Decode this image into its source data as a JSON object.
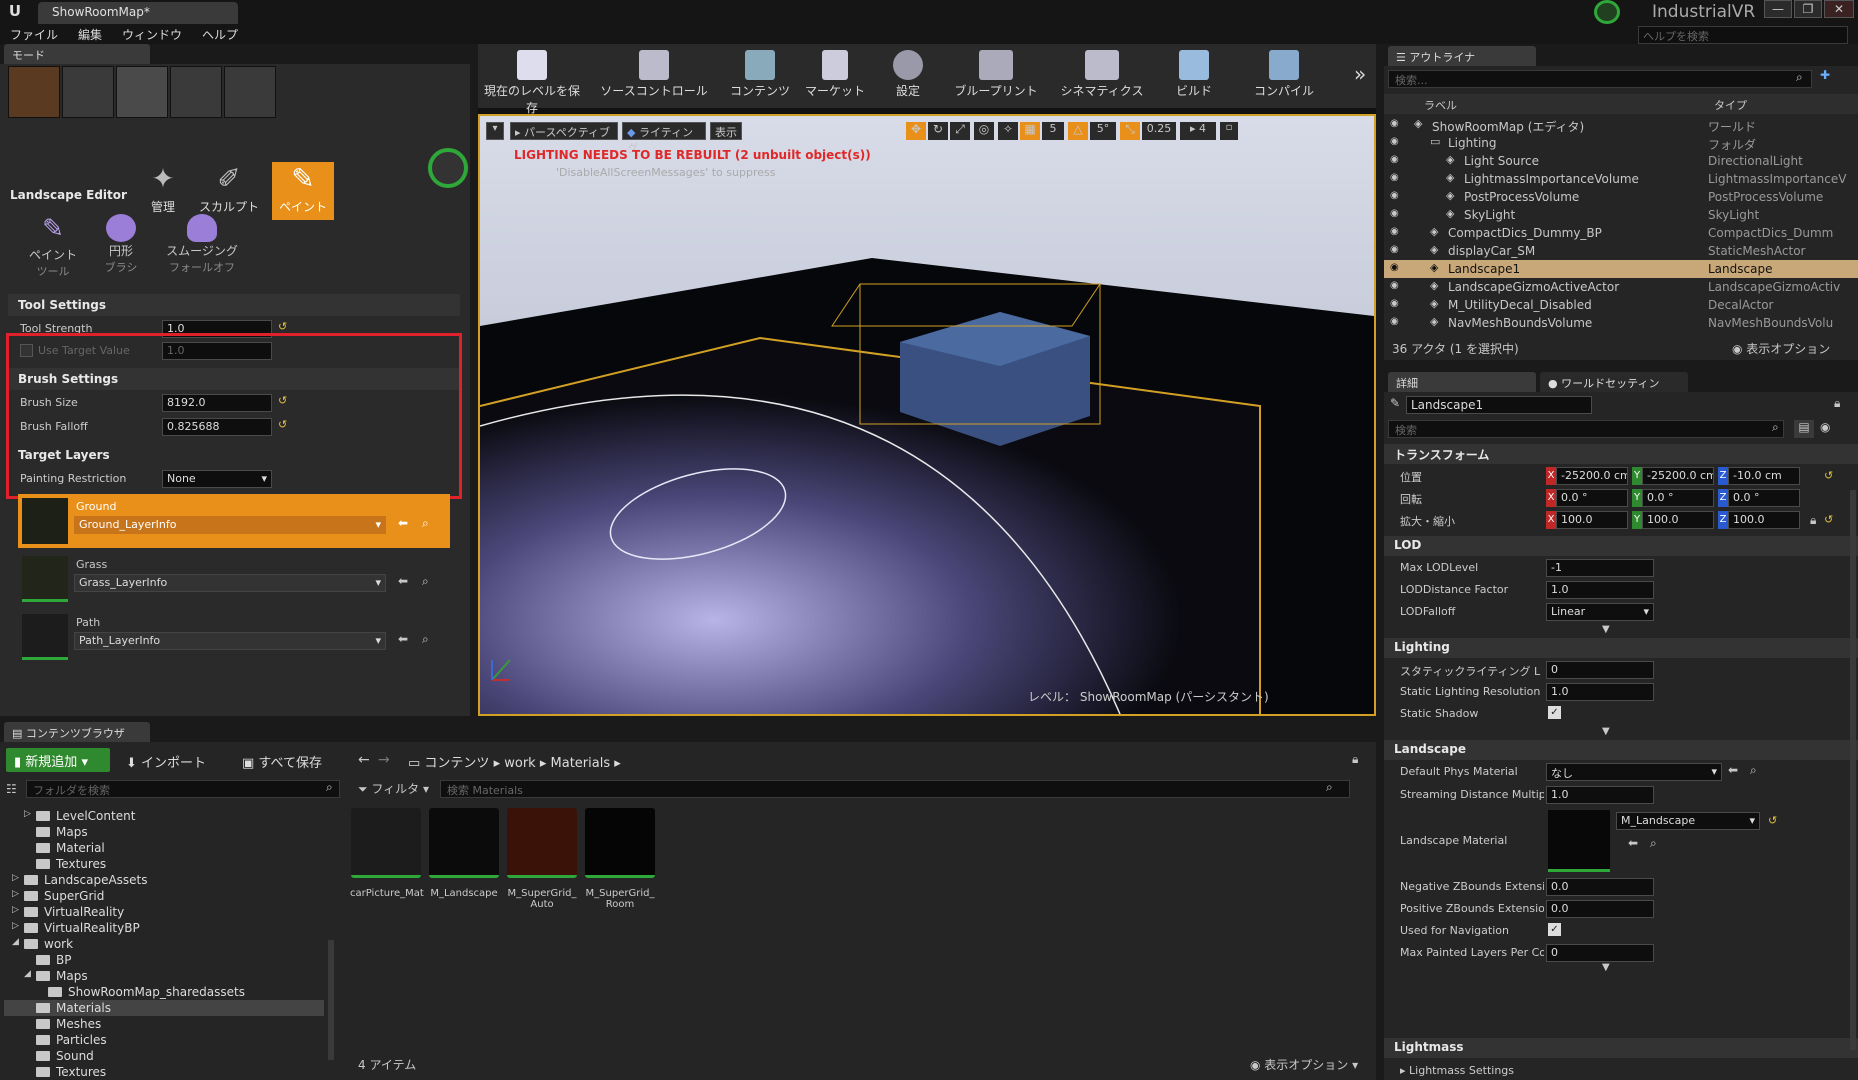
{
  "window": {
    "app_icon": "unreal-logo",
    "tab_title": "ShowRoomMap*",
    "app_name": "IndustrialVR",
    "help_search_placeholder": "ヘルプを検索",
    "controls": [
      "—",
      "❐",
      "✕"
    ]
  },
  "menu": [
    "ファイル",
    "編集",
    "ウィンドウ",
    "ヘルプ"
  ],
  "modes": {
    "tab_label": "モード",
    "sub_modes": [
      {
        "label": "管理",
        "icon": "manage-icon"
      },
      {
        "label": "スカルプト",
        "icon": "sculpt-icon"
      },
      {
        "label": "ペイント",
        "icon": "paint-icon",
        "active": true
      }
    ],
    "landscape_editor_title": "Landscape Editor",
    "tools": [
      {
        "label": "ペイント",
        "sub": "ツール"
      },
      {
        "label": "円形",
        "sub": "ブラシ"
      },
      {
        "label": "スムージング",
        "sub": "フォールオフ"
      }
    ],
    "tool_settings": {
      "title": "Tool Settings",
      "tool_strength_label": "Tool Strength",
      "tool_strength": "1.0",
      "use_target_label": "Use Target Value",
      "use_target_value": "1.0"
    },
    "brush_settings": {
      "title": "Brush Settings",
      "size_label": "Brush Size",
      "size": "8192.0",
      "falloff_label": "Brush Falloff",
      "falloff": "0.825688"
    },
    "target_layers_title": "Target Layers",
    "painting_restriction_label": "Painting Restriction",
    "painting_restriction": "None",
    "layers": [
      {
        "name": "Ground",
        "info": "Ground_LayerInfo",
        "selected": true
      },
      {
        "name": "Grass",
        "info": "Grass_LayerInfo",
        "selected": false
      },
      {
        "name": "Path",
        "info": "Path_LayerInfo",
        "selected": false
      }
    ]
  },
  "toolbar": [
    {
      "label": "現在のレベルを保存",
      "icon": "save-icon"
    },
    {
      "label": "ソースコントロール",
      "icon": "source-control-icon"
    },
    {
      "label": "コンテンツ",
      "icon": "content-icon"
    },
    {
      "label": "マーケット",
      "icon": "market-icon"
    },
    {
      "label": "設定",
      "icon": "settings-icon"
    },
    {
      "label": "ブループリント",
      "icon": "blueprint-icon"
    },
    {
      "label": "シネマティクス",
      "icon": "cinematics-icon"
    },
    {
      "label": "ビルド",
      "icon": "build-icon"
    },
    {
      "label": "コンパイル",
      "icon": "compile-icon"
    }
  ],
  "viewport": {
    "perspective": "パースペクティブ",
    "lighting": "ライティング",
    "show": "表示",
    "grid_snap": "5",
    "rot_snap": "5°",
    "scale_snap": "0.25",
    "cam_speed": "4",
    "warning": "LIGHTING NEEDS TO BE REBUILT (2 unbuilt object(s))",
    "warning_sub": "'DisableAllScreenMessages' to suppress",
    "level_label": "レベル：",
    "level_name": "ShowRoomMap (パーシスタント)",
    "colors": {
      "warning": "#e02828",
      "selection": "#d2a024"
    }
  },
  "outliner": {
    "tab": "アウトライナ",
    "search_placeholder": "検索...",
    "col_label": "ラベル",
    "col_type": "タイプ",
    "rows": [
      {
        "label": "ShowRoomMap (エディタ)",
        "type": "ワールド",
        "indent": 0,
        "icon": "world-icon"
      },
      {
        "label": "Lighting",
        "type": "フォルダ",
        "indent": 1,
        "icon": "folder-icon"
      },
      {
        "label": "Light Source",
        "type": "DirectionalLight",
        "indent": 2,
        "icon": "light-icon"
      },
      {
        "label": "LightmassImportanceVolume",
        "type": "LightmassImportanceV",
        "indent": 2,
        "icon": "volume-icon"
      },
      {
        "label": "PostProcessVolume",
        "type": "PostProcessVolume",
        "indent": 2,
        "icon": "volume-icon"
      },
      {
        "label": "SkyLight",
        "type": "SkyLight",
        "indent": 2,
        "icon": "skylight-icon"
      },
      {
        "label": "CompactDics_Dummy_BP",
        "type": "CompactDics_Dumm",
        "indent": 1,
        "icon": "actor-icon"
      },
      {
        "label": "displayCar_SM",
        "type": "StaticMeshActor",
        "indent": 1,
        "icon": "mesh-icon"
      },
      {
        "label": "Landscape1",
        "type": "Landscape",
        "indent": 1,
        "icon": "landscape-icon",
        "selected": true
      },
      {
        "label": "LandscapeGizmoActiveActor",
        "type": "LandscapeGizmoActiv",
        "indent": 1,
        "icon": "gizmo-icon"
      },
      {
        "label": "M_UtilityDecal_Disabled",
        "type": "DecalActor",
        "indent": 1,
        "icon": "decal-icon"
      },
      {
        "label": "NavMeshBoundsVolume",
        "type": "NavMeshBoundsVolu",
        "indent": 1,
        "icon": "volume-icon"
      }
    ],
    "footer_count": "36 アクタ (1 を選択中)",
    "footer_options": "表示オプション"
  },
  "details": {
    "tab": "詳細",
    "tab2": "ワールドセッティン",
    "object_name": "Landscape1",
    "search_placeholder": "検索",
    "transform_title": "トランスフォーム",
    "location_label": "位置",
    "location": [
      "-25200.0 cm",
      "-25200.0 cm",
      "-10.0 cm"
    ],
    "rotation_label": "回転",
    "rotation": [
      "0.0 °",
      "0.0 °",
      "0.0 °"
    ],
    "scale_label": "拡大・縮小",
    "scale": [
      "100.0",
      "100.0",
      "100.0"
    ],
    "lod_title": "LOD",
    "max_lod_label": "Max LODLevel",
    "max_lod": "-1",
    "lod_distance_label": "LODDistance Factor",
    "lod_distance": "1.0",
    "lod_falloff_label": "LODFalloff",
    "lod_falloff": "Linear",
    "lighting_title": "Lighting",
    "static_lighting_lod_label": "スタティックライティング L",
    "static_lighting_lod": "0",
    "static_lighting_res_label": "Static Lighting Resolution",
    "static_lighting_res": "1.0",
    "static_shadow_label": "Static Shadow",
    "landscape_title": "Landscape",
    "default_phys_label": "Default Phys Material",
    "default_phys": "なし",
    "stream_dist_label": "Streaming Distance Multiplie",
    "stream_dist": "1.0",
    "landscape_material_label": "Landscape Material",
    "landscape_material": "M_Landscape",
    "neg_z_label": "Negative ZBounds Extension",
    "neg_z": "0.0",
    "pos_z_label": "Positive ZBounds Extension",
    "pos_z": "0.0",
    "used_nav_label": "Used for Navigation",
    "max_painted_label": "Max Painted Layers Per Con",
    "max_painted": "0",
    "lightmass_title": "Lightmass",
    "lightmass_settings": "Lightmass Settings"
  },
  "content_browser": {
    "tab": "コンテンツブラウザ",
    "add_new": "新規追加",
    "import": "インポート",
    "save_all": "すべて保存",
    "path": [
      "コンテンツ",
      "work",
      "Materials"
    ],
    "folder_search": "フォルダを検索",
    "filter": "フィルタ",
    "asset_search": "検索 Materials",
    "folders": [
      {
        "name": "LevelContent",
        "indent": 1,
        "arrow": true
      },
      {
        "name": "Maps",
        "indent": 1,
        "arrow": false
      },
      {
        "name": "Material",
        "indent": 1,
        "arrow": false
      },
      {
        "name": "Textures",
        "indent": 1,
        "arrow": false
      },
      {
        "name": "LandscapeAssets",
        "indent": 0,
        "arrow": true
      },
      {
        "name": "SuperGrid",
        "indent": 0,
        "arrow": true
      },
      {
        "name": "VirtualReality",
        "indent": 0,
        "arrow": true
      },
      {
        "name": "VirtualRealityBP",
        "indent": 0,
        "arrow": true
      },
      {
        "name": "work",
        "indent": 0,
        "arrow": true,
        "open": true
      },
      {
        "name": "BP",
        "indent": 1,
        "arrow": false
      },
      {
        "name": "Maps",
        "indent": 1,
        "arrow": true,
        "open": true
      },
      {
        "name": "ShowRoomMap_sharedassets",
        "indent": 2,
        "arrow": false
      },
      {
        "name": "Materials",
        "indent": 1,
        "arrow": false,
        "selected": true
      },
      {
        "name": "Meshes",
        "indent": 1,
        "arrow": false
      },
      {
        "name": "Particles",
        "indent": 1,
        "arrow": false
      },
      {
        "name": "Sound",
        "indent": 1,
        "arrow": false
      },
      {
        "name": "Textures",
        "indent": 1,
        "arrow": false
      }
    ],
    "assets": [
      {
        "name": "carPicture_Mat",
        "name2": "",
        "thumb": "#1c1c1c"
      },
      {
        "name": "M_Landscape",
        "name2": "",
        "thumb": "#0b0b0b"
      },
      {
        "name": "M_SuperGrid_",
        "name2": "Auto",
        "thumb": "#3a1208"
      },
      {
        "name": "M_SuperGrid_",
        "name2": "Room",
        "thumb": "#050505"
      }
    ],
    "item_count": "4 アイテム",
    "view_options": "表示オプション"
  }
}
